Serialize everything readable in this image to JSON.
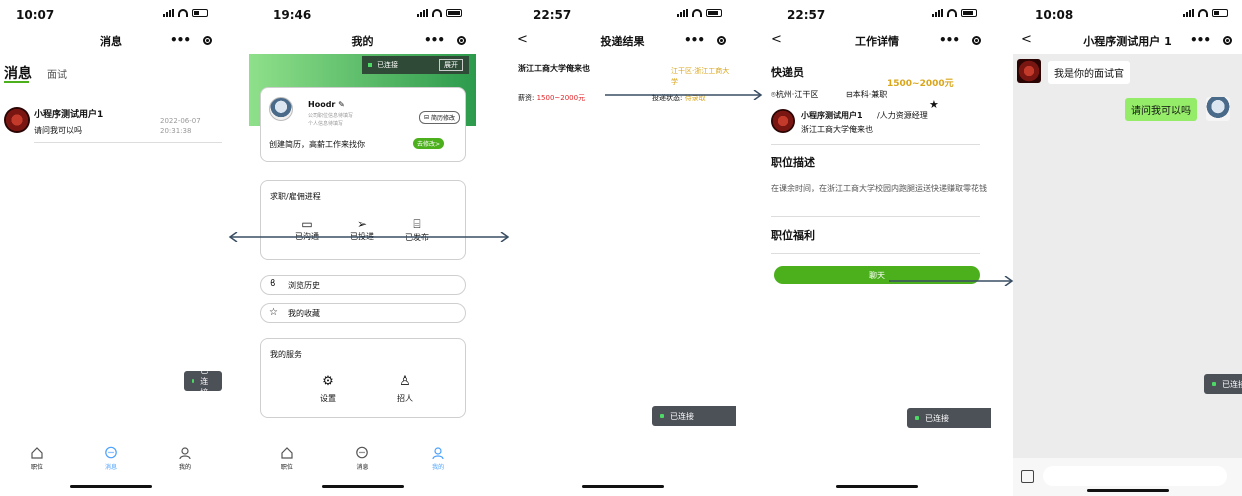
{
  "screen1": {
    "time": "10:07",
    "title": "消息",
    "tabs": [
      "消息",
      "面试"
    ],
    "msg": {
      "name": "小程序测试用户1",
      "text": "请问我可以吗",
      "date": "2022-06-07",
      "clock": "20:31:38"
    },
    "toast": "已连接",
    "tabbar": [
      "职位",
      "消息",
      "我的"
    ]
  },
  "screen2": {
    "time": "19:46",
    "title": "我的",
    "connected": "已连接",
    "expand": "展开",
    "username": "Hoodr",
    "sub1": "公司职位信息待填写",
    "sub2": "个人信息待填写",
    "resume_btn": "简历修改",
    "resume_text": "创建简历，高薪工作来找你",
    "go_edit": "去修改>",
    "progress_title": "求职/雇佣进程",
    "progress_items": [
      "已沟通",
      "已投递",
      "已发布"
    ],
    "history": "浏览历史",
    "favorites": "我的收藏",
    "services_title": "我的服务",
    "services": [
      "设置",
      "招人"
    ],
    "tabbar": [
      "职位",
      "消息",
      "我的"
    ]
  },
  "screen3": {
    "time": "22:57",
    "title": "投递结果",
    "company": "浙江工商大学俺来也",
    "salary_label": "薪资:",
    "salary": "1500~2000元",
    "location": "江干区·浙江工商大学",
    "status_label": "投递状态:",
    "status": "待录取",
    "toast": "已连接"
  },
  "screen4": {
    "time": "22:57",
    "title": "工作详情",
    "job": "快递员",
    "salary": "1500~2000元",
    "location": "杭州·江干区",
    "edu": "本科·兼职",
    "poster": "小程序测试用户1",
    "role": "/人力资源经理",
    "org": "浙江工商大学俺来也",
    "desc_title": "职位描述",
    "desc": "在课余时间，在浙江工商大学校园内跑腿运送快递赚取零花钱",
    "welfare_title": "职位福利",
    "chat_btn": "聊天",
    "toast": "已连接"
  },
  "screen5": {
    "time": "10:08",
    "title": "小程序测试用户 1",
    "msg_in": "我是你的面试官",
    "msg_out": "请问我可以吗",
    "toast": "已连接"
  },
  "colors": {
    "green": "#4caf1c",
    "red": "#e0262a",
    "gold": "#d9a51a",
    "toast": "#4c5057",
    "arrow": "#3a4e63"
  }
}
